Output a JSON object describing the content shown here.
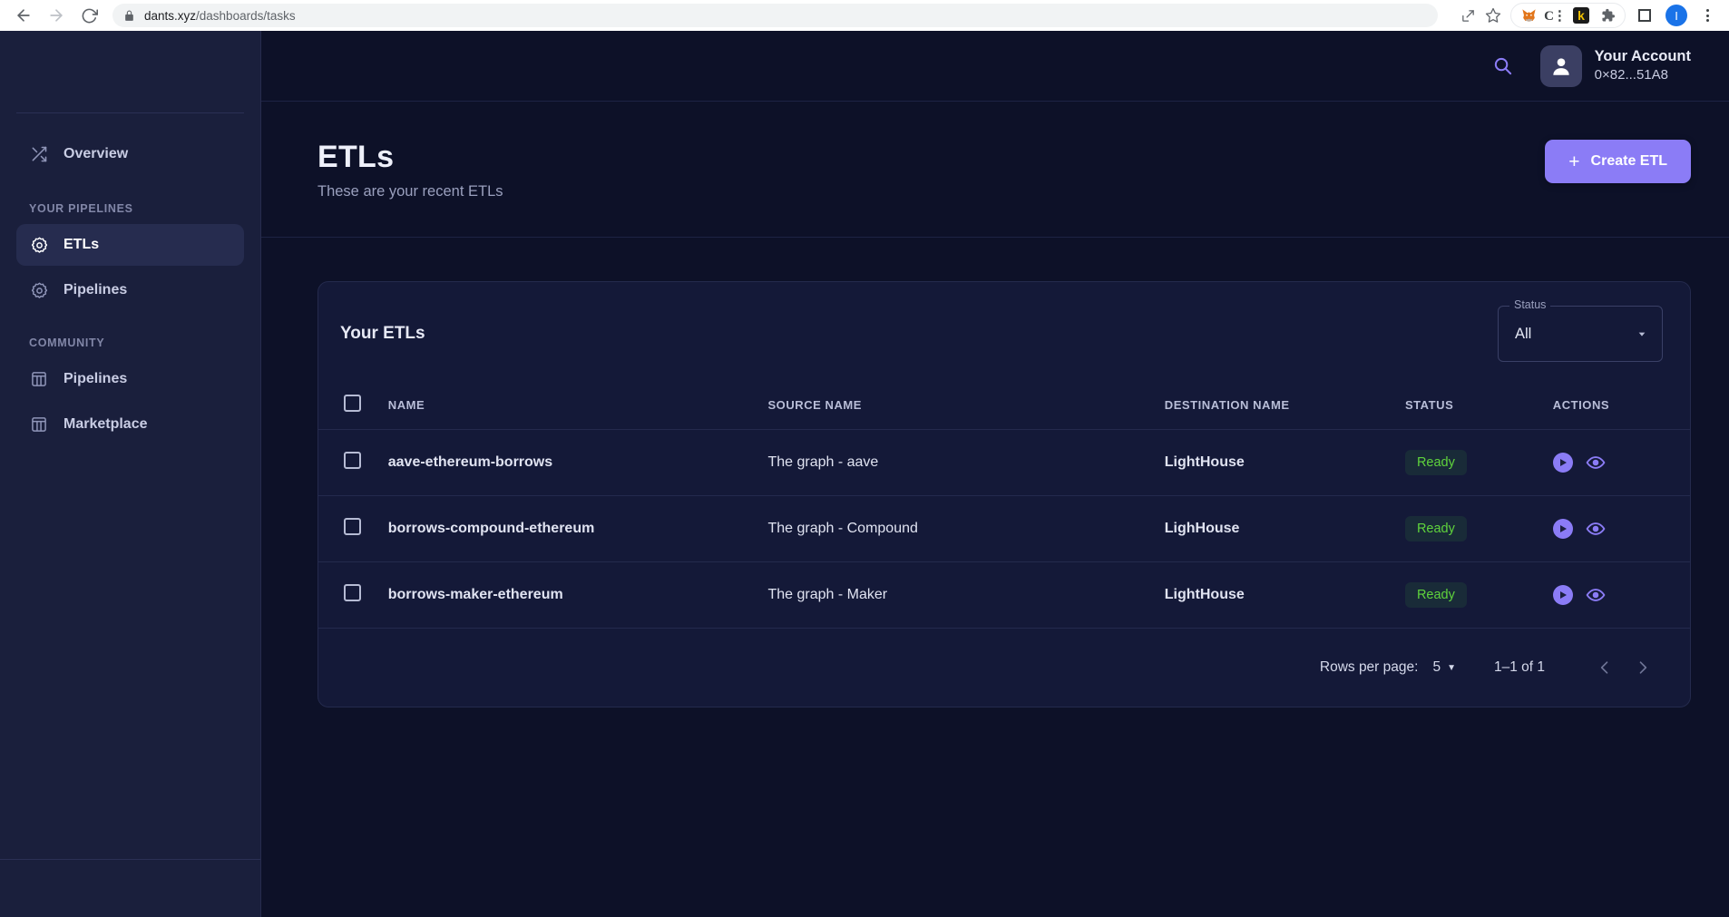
{
  "browser": {
    "back_label": "Back",
    "forward_label": "Forward",
    "reload_label": "Reload",
    "url_domain": "dants.xyz",
    "url_path": "/dashboards/tasks",
    "lock_icon": "lock-icon",
    "share_icon": "share-icon",
    "bookmark_icon": "star-icon",
    "extensions": [
      {
        "name": "metamask-extension-icon",
        "glyph": "🦊"
      },
      {
        "name": "c-extension-icon",
        "glyph": "C⋮"
      },
      {
        "name": "keplr-extension-icon",
        "glyph": "k"
      },
      {
        "name": "extensions-puzzle-icon",
        "glyph": "puzzle"
      }
    ],
    "side_panel_icon": "side-panel-icon",
    "profile_initial": "I",
    "menu_icon": "kebab-menu-icon"
  },
  "sidebar": {
    "overview": {
      "label": "Overview",
      "icon": "shuffle-icon"
    },
    "sections": [
      {
        "heading": "YOUR PIPELINES",
        "items": [
          {
            "label": "ETLs",
            "icon": "gear-sun-icon",
            "active": true
          },
          {
            "label": "Pipelines",
            "icon": "gear-sun-icon",
            "active": false
          }
        ]
      },
      {
        "heading": "COMMUNITY",
        "items": [
          {
            "label": "Pipelines",
            "icon": "table-icon",
            "active": false
          },
          {
            "label": "Marketplace",
            "icon": "table-icon",
            "active": false
          }
        ]
      }
    ]
  },
  "topbar": {
    "search_icon": "search-icon",
    "account_name": "Your Account",
    "account_address": "0×82...51A8",
    "avatar_icon": "person-icon"
  },
  "page": {
    "title": "ETLs",
    "subtitle": "These are your recent ETLs",
    "create_button": "Create ETL",
    "create_button_icon": "plus-icon"
  },
  "card": {
    "title": "Your ETLs",
    "status_filter": {
      "label": "Status",
      "value": "All",
      "caret_icon": "chevron-down-icon"
    }
  },
  "table": {
    "columns": [
      "NAME",
      "SOURCE NAME",
      "DESTINATION NAME",
      "STATUS",
      "ACTIONS"
    ],
    "select_all_checkbox": "unchecked",
    "rows": [
      {
        "name": "aave-ethereum-borrows",
        "source": "The graph - aave",
        "destination": "LightHouse",
        "status": "Ready",
        "checked": false,
        "actions": [
          "run-icon",
          "view-icon"
        ]
      },
      {
        "name": "borrows-compound-ethereum",
        "source": "The graph - Compound",
        "destination": "LighHouse",
        "status": "Ready",
        "checked": false,
        "actions": [
          "run-icon",
          "view-icon"
        ]
      },
      {
        "name": "borrows-maker-ethereum",
        "source": "The graph - Maker",
        "destination": "LightHouse",
        "status": "Ready",
        "checked": false,
        "actions": [
          "run-icon",
          "view-icon"
        ]
      }
    ]
  },
  "pagination": {
    "rows_per_page_label": "Rows per page:",
    "rows_per_page_value": "5",
    "range_label": "1–1 of 1",
    "prev_icon": "chevron-left-icon",
    "next_icon": "chevron-right-icon"
  },
  "colors": {
    "accent": "#8b7cf6",
    "status_ready": "#5fd33c",
    "sidebar_bg": "#1a1f3c",
    "main_bg": "#0d1128",
    "card_bg": "#141938"
  }
}
